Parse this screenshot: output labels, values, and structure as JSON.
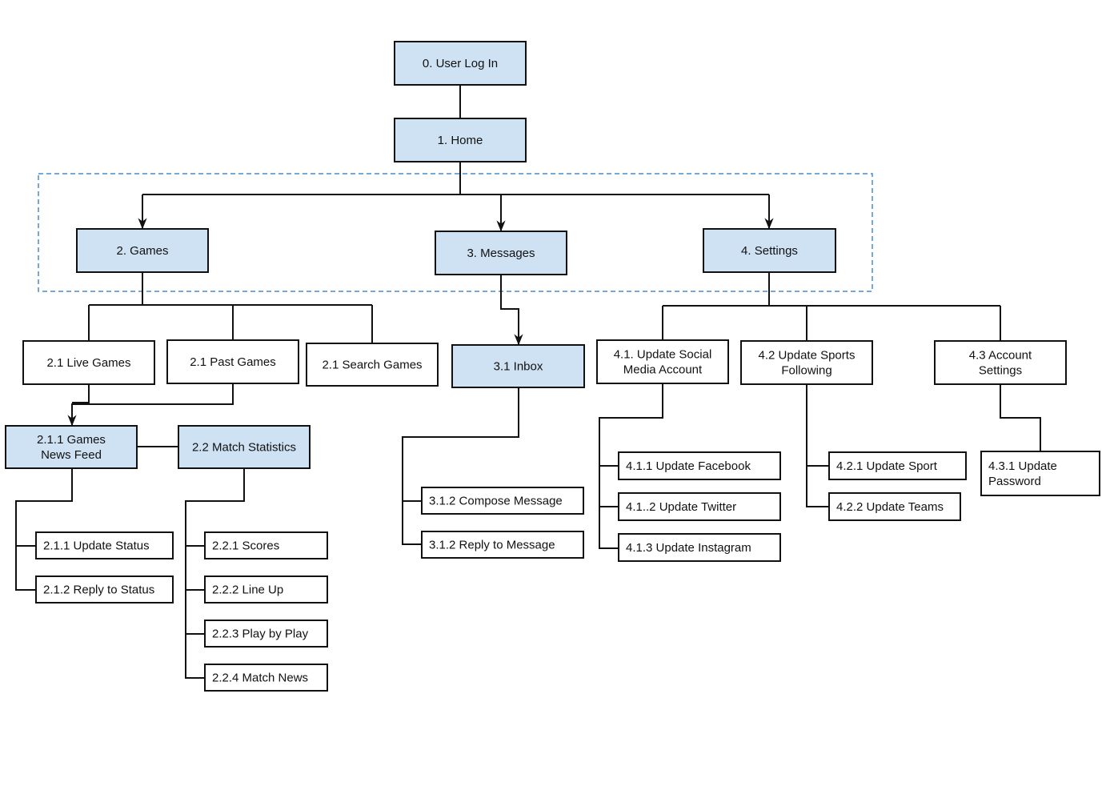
{
  "colors": {
    "highlight_fill": "#cfe2f3",
    "plain_fill": "#ffffff",
    "stroke": "#111111",
    "group_border": "#4a8bc9"
  },
  "nodes": [
    {
      "id": "n0",
      "lines": [
        "0. User Log In"
      ],
      "highlighted": true
    },
    {
      "id": "n1",
      "lines": [
        "1. Home"
      ],
      "highlighted": true
    },
    {
      "id": "n2",
      "lines": [
        "2. Games"
      ],
      "highlighted": true
    },
    {
      "id": "n3",
      "lines": [
        "3. Messages"
      ],
      "highlighted": true
    },
    {
      "id": "n4",
      "lines": [
        "4. Settings"
      ],
      "highlighted": true
    },
    {
      "id": "live",
      "lines": [
        "2.1 Live Games"
      ],
      "highlighted": false
    },
    {
      "id": "past",
      "lines": [
        "2.1 Past Games"
      ],
      "highlighted": false
    },
    {
      "id": "search",
      "lines": [
        "2.1 Search Games"
      ],
      "highlighted": false
    },
    {
      "id": "inbox",
      "lines": [
        "3.1 Inbox"
      ],
      "highlighted": true
    },
    {
      "id": "s41",
      "lines": [
        "4.1. Update Social",
        "Media Account"
      ],
      "highlighted": false
    },
    {
      "id": "s42",
      "lines": [
        "4.2 Update Sports",
        "Following"
      ],
      "highlighted": false
    },
    {
      "id": "s43",
      "lines": [
        "4.3 Account",
        "Settings"
      ],
      "highlighted": false
    },
    {
      "id": "feed",
      "lines": [
        "2.1.1 Games",
        "News Feed"
      ],
      "highlighted": true
    },
    {
      "id": "match",
      "lines": [
        "2.2 Match Statistics"
      ],
      "highlighted": true
    },
    {
      "id": "u1",
      "lines": [
        "2.1.1 Update Status"
      ],
      "highlighted": false
    },
    {
      "id": "u2",
      "lines": [
        "2.1.2 Reply to Status"
      ],
      "highlighted": false
    },
    {
      "id": "m1",
      "lines": [
        "2.2.1 Scores"
      ],
      "highlighted": false
    },
    {
      "id": "m2",
      "lines": [
        "2.2.2 Line Up"
      ],
      "highlighted": false
    },
    {
      "id": "m3",
      "lines": [
        "2.2.3  Play by Play"
      ],
      "highlighted": false
    },
    {
      "id": "m4",
      "lines": [
        "2.2.4 Match News"
      ],
      "highlighted": false
    },
    {
      "id": "c1",
      "lines": [
        "3.1.2 Compose Message"
      ],
      "highlighted": false
    },
    {
      "id": "c2",
      "lines": [
        "3.1.2 Reply to Message"
      ],
      "highlighted": false
    },
    {
      "id": "f1",
      "lines": [
        "4.1.1 Update Facebook"
      ],
      "highlighted": false
    },
    {
      "id": "f2",
      "lines": [
        "4.1..2 Update Twitter"
      ],
      "highlighted": false
    },
    {
      "id": "f3",
      "lines": [
        "4.1.3 Update Instagram"
      ],
      "highlighted": false
    },
    {
      "id": "p1",
      "lines": [
        "4.2.1 Update Sport"
      ],
      "highlighted": false
    },
    {
      "id": "p2",
      "lines": [
        "4.2.2 Update Teams"
      ],
      "highlighted": false
    },
    {
      "id": "pw",
      "lines": [
        "4.3.1 Update",
        "Password"
      ],
      "highlighted": false
    }
  ]
}
